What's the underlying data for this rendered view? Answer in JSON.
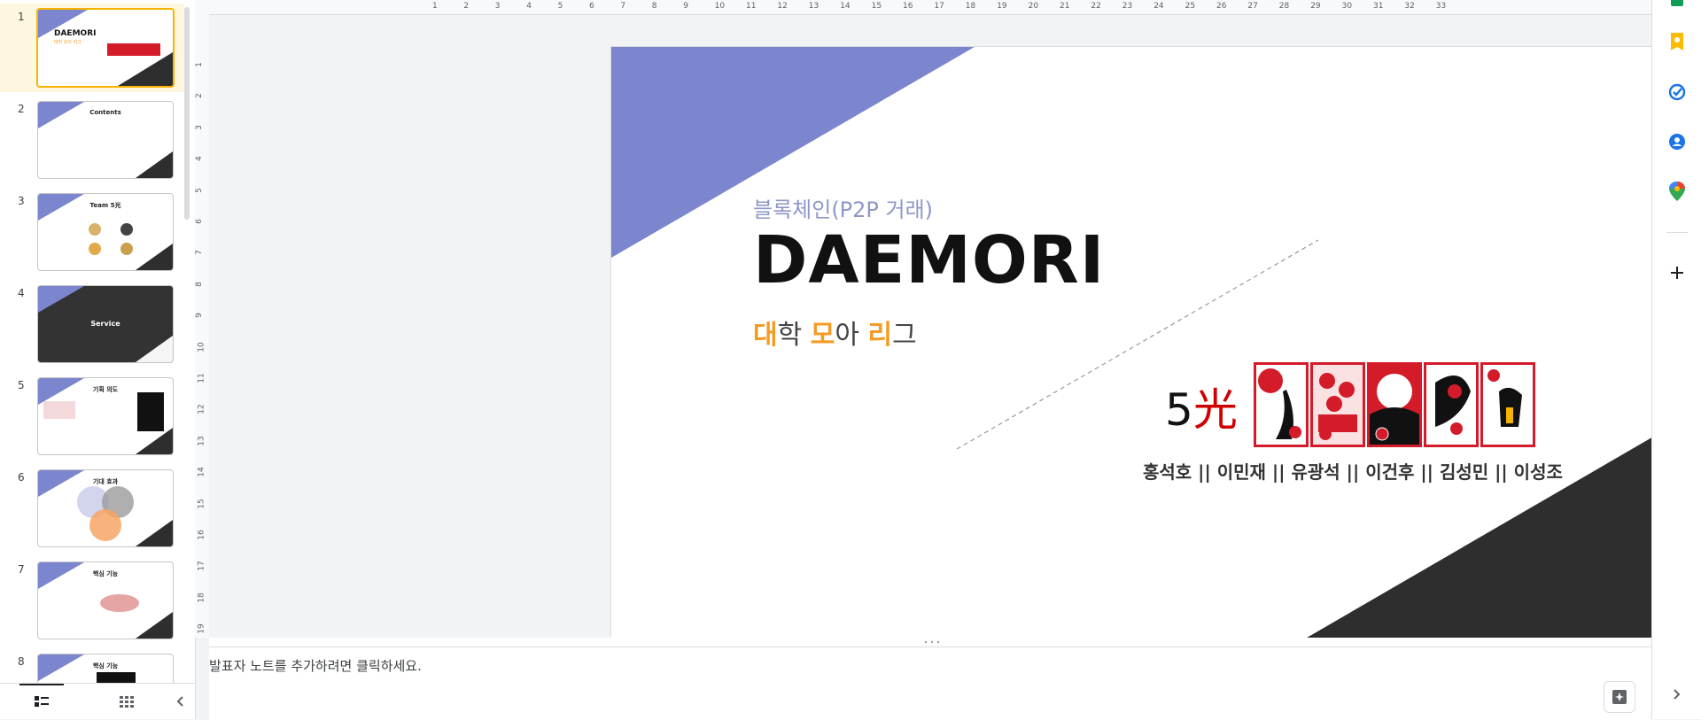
{
  "filmstrip": {
    "slides": [
      {
        "number": "1",
        "title": "DAEMORI",
        "subtitle": "대학 모아 리그"
      },
      {
        "number": "2",
        "title": "Contents"
      },
      {
        "number": "3",
        "title": "Team 5光"
      },
      {
        "number": "4",
        "title": "Service"
      },
      {
        "number": "5",
        "title": "기획 의도"
      },
      {
        "number": "6",
        "title": "기대 효과"
      },
      {
        "number": "7",
        "title": "핵심 기능"
      },
      {
        "number": "8",
        "title": "핵심 기능"
      }
    ]
  },
  "ruler": {
    "top_labels": [
      "1",
      "2",
      "3",
      "4",
      "5",
      "6",
      "7",
      "8",
      "9",
      "10",
      "11",
      "12",
      "13",
      "14",
      "15",
      "16",
      "17",
      "18",
      "19",
      "20",
      "21",
      "22",
      "23",
      "24",
      "25",
      "26",
      "27",
      "28",
      "29",
      "30",
      "31",
      "32",
      "33"
    ],
    "left_labels": [
      "1",
      "2",
      "3",
      "4",
      "5",
      "6",
      "7",
      "8",
      "9",
      "10",
      "11",
      "12",
      "13",
      "14",
      "15",
      "16",
      "17",
      "18",
      "19"
    ]
  },
  "slide": {
    "subtitle": "블록체인(P2P 거래)",
    "title": "DAEMORI",
    "tagline": {
      "a1": "대",
      "b1": "학 ",
      "a2": "모",
      "b2": "아 ",
      "a3": "리",
      "b3": "그"
    },
    "count_number": "5",
    "count_kanji": "光",
    "members": "홍석호 || 이민재 || 유광석 || 이건후 || 김성민 || 이성조",
    "colors": {
      "triangle_top": "#7b86cf",
      "triangle_bottom": "#2e2e2e",
      "accent_orange": "#f39b23",
      "accent_red": "#d10000"
    }
  },
  "notes": {
    "placeholder": "발표자 노트를 추가하려면 클릭하세요."
  },
  "side_panel": {
    "icons": [
      "sheets-icon",
      "keep-icon",
      "tasks-icon",
      "contacts-icon",
      "maps-icon",
      "add-icon",
      "expand-panel-icon"
    ]
  }
}
